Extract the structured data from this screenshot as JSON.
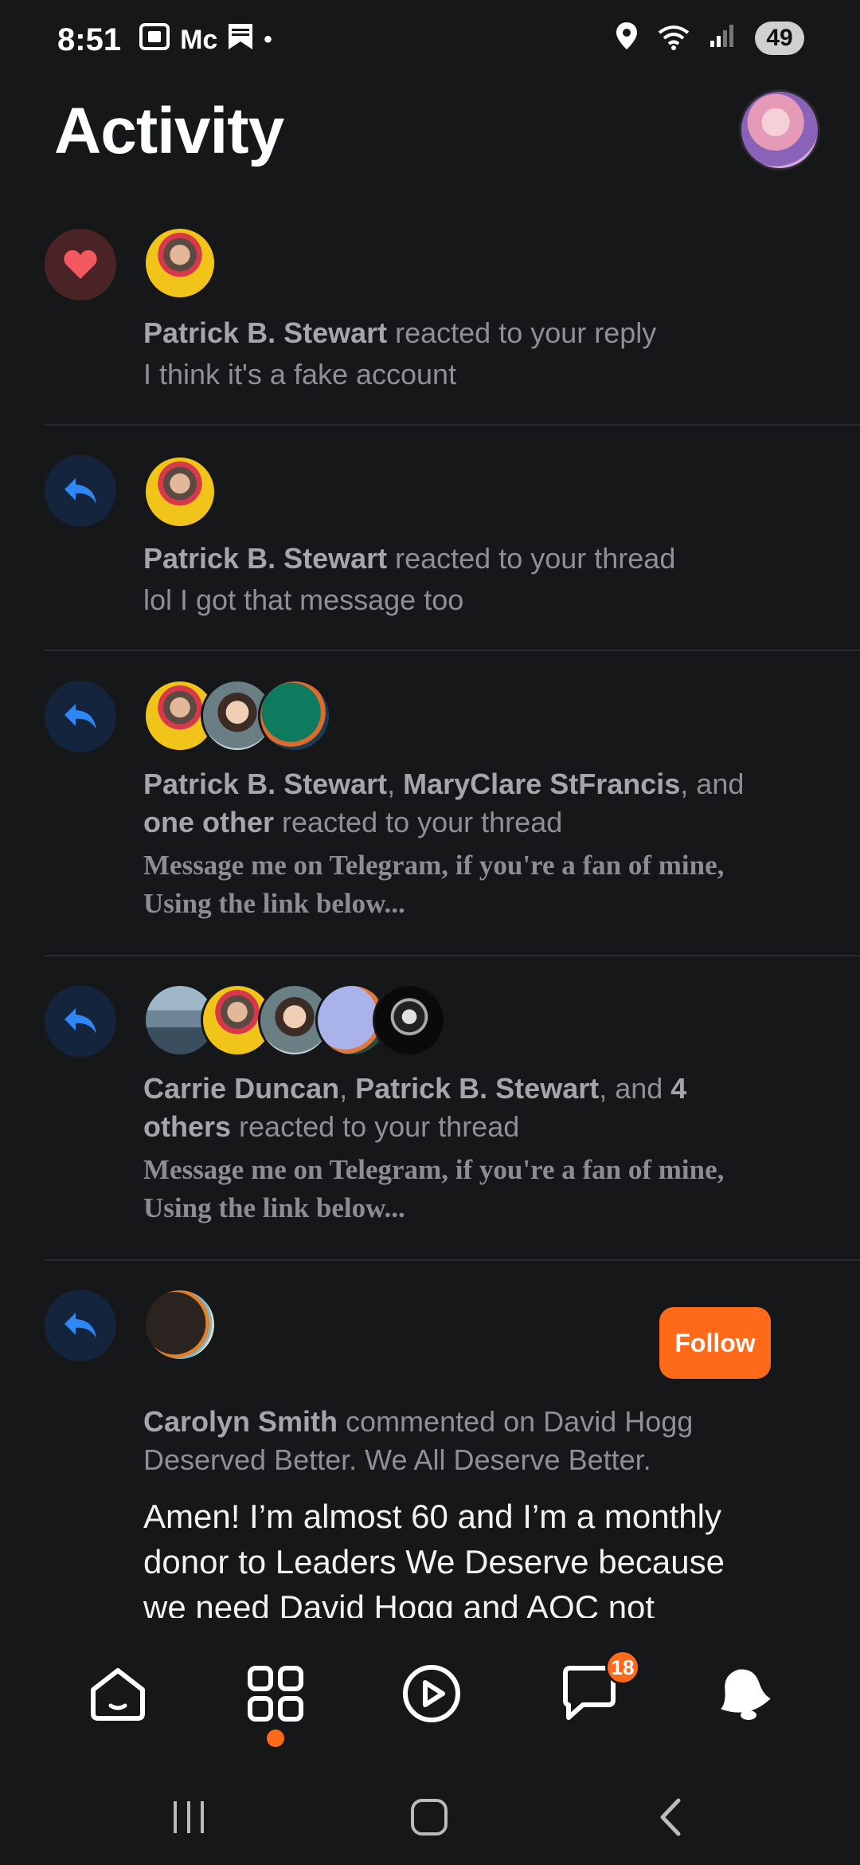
{
  "status_bar": {
    "time": "8:51",
    "left_text": "Mc",
    "battery": "49"
  },
  "header": {
    "title": "Activity"
  },
  "activity": [
    {
      "type": "heart-icon",
      "actors": [
        "Patrick B. Stewart"
      ],
      "action": " reacted to your reply",
      "snippet": "I think it's a fake account"
    },
    {
      "type": "reply-icon",
      "actors": [
        "Patrick B. Stewart"
      ],
      "action": " reacted to your thread",
      "snippet": "lol I got that message too"
    },
    {
      "type": "reply-icon",
      "actor1": "Patrick B. Stewart",
      "sep1": ", ",
      "actor2": "MaryClare StFrancis",
      "sep2": ", and",
      "actor3": "one other",
      "action": " reacted to your thread",
      "snippet_line1": "Message me on Telegram, if you're a fan of mine,",
      "snippet_line2": "Using the link below..."
    },
    {
      "type": "reply-icon",
      "actor1": "Carrie Duncan",
      "sep1": ", ",
      "actor2": "Patrick B. Stewart",
      "sep2": ", and ",
      "actor3a": "4",
      "actor3b": "others",
      "action": " reacted to your thread",
      "snippet_line1": "Message me on Telegram, if you're a fan of mine,",
      "snippet_line2": "Using the link below..."
    },
    {
      "type": "reply-icon",
      "actor": "Carolyn Smith",
      "action": " commented on David Hogg",
      "action_line2": "Deserved Better. We All Deserve Better.",
      "follow_label": "Follow",
      "comment_line1": "Amen! I’m almost 60 and I’m a monthly",
      "comment_line2": "donor to Leaders We Deserve because",
      "comment_line3": "we need David Hogg and AOC not"
    }
  ],
  "bottom_nav": {
    "items": [
      "home-icon",
      "grid-icon",
      "play-icon",
      "chat-icon",
      "bell-icon"
    ],
    "chat_badge": "18",
    "active": "grid-icon"
  },
  "colors": {
    "accent": "#ff6a1a",
    "background": "#161719",
    "reply_icon": "#2f86f5",
    "heart": "#f25a5f"
  }
}
